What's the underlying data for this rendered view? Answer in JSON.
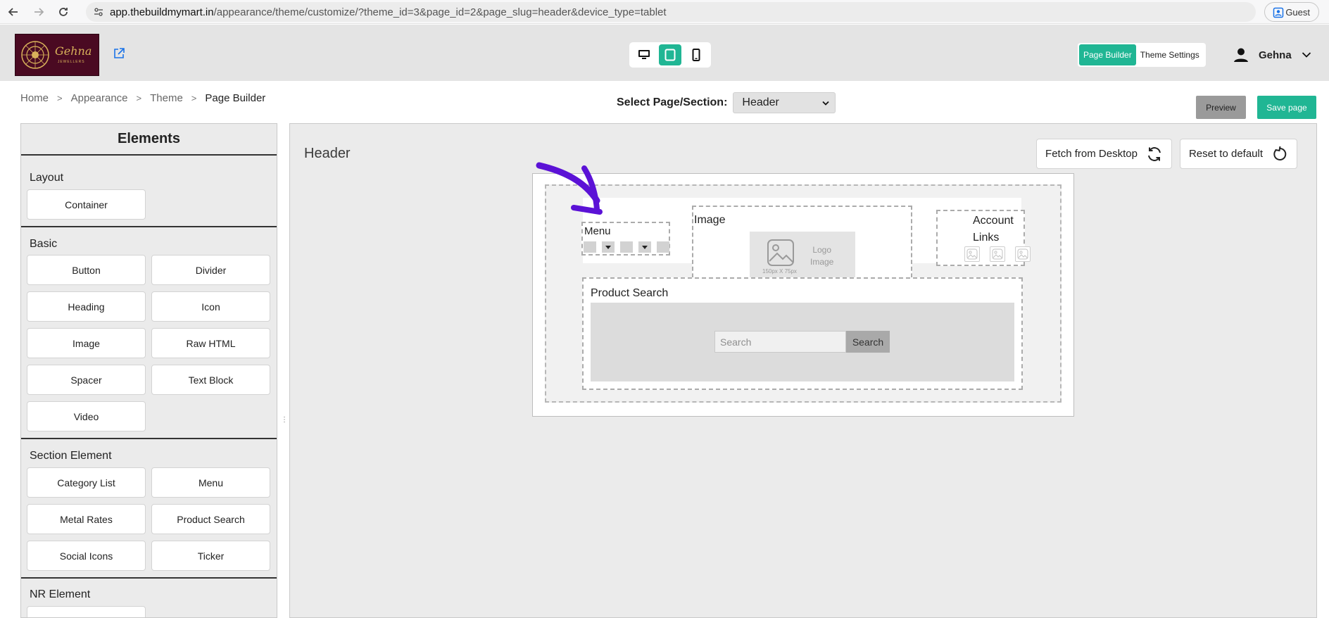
{
  "browser": {
    "url_domain": "app.thebuildmymart.in",
    "url_path": "/appearance/theme/customize/?theme_id=3&page_id=2&page_slug=header&device_type=tablet",
    "profile_label": "Guest"
  },
  "appbar": {
    "logo_text": "Gehna",
    "logo_subtext": "JEWELLERS",
    "devices": [
      "desktop",
      "tablet",
      "mobile"
    ],
    "active_device": "tablet",
    "modes": [
      "Page Builder",
      "Theme Settings"
    ],
    "active_mode": "Page Builder",
    "user_name": "Gehna",
    "accent_color": "#20b694"
  },
  "breadcrumb": {
    "items": [
      "Home",
      "Appearance",
      "Theme"
    ],
    "current": "Page Builder"
  },
  "section_select": {
    "label": "Select Page/Section:",
    "value": "Header"
  },
  "actions": {
    "preview": "Preview",
    "save": "Save page"
  },
  "elements_panel": {
    "title": "Elements",
    "groups": [
      {
        "name": "Layout",
        "items": [
          "Container"
        ]
      },
      {
        "name": "Basic",
        "items": [
          "Button",
          "Divider",
          "Heading",
          "Icon",
          "Image",
          "Raw HTML",
          "Spacer",
          "Text Block",
          "Video"
        ]
      },
      {
        "name": "Section Element",
        "items": [
          "Category List",
          "Menu",
          "Metal Rates",
          "Product Search",
          "Social Icons",
          "Ticker"
        ]
      },
      {
        "name": "NR Element",
        "items": []
      }
    ]
  },
  "canvas": {
    "title": "Header",
    "fetch_label": "Fetch from Desktop",
    "reset_label": "Reset to default",
    "blocks": {
      "menu_label": "Menu",
      "image_label": "Image",
      "logo_placeholder_line1": "Logo",
      "logo_placeholder_line2": "Image",
      "logo_placeholder_size": "150px X 75px",
      "account_line1": "Account",
      "account_line2": "Links",
      "search_label": "Product Search",
      "search_placeholder": "Search",
      "search_button": "Search"
    },
    "annotation_color": "#5b12d6"
  }
}
